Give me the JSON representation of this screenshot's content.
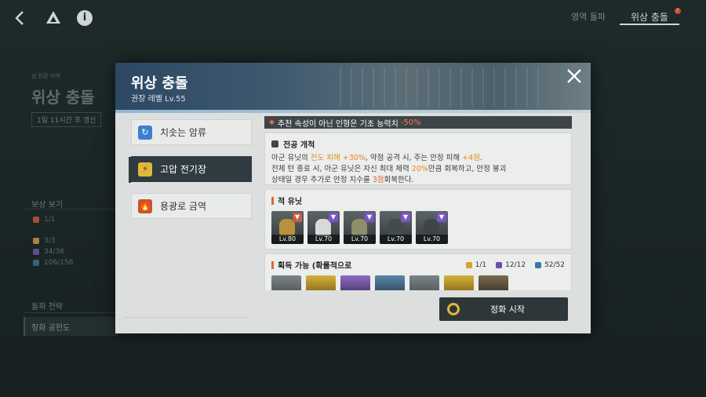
{
  "topbar": {
    "back_icon": "back-arrow-icon",
    "logo_icon": "triangle-logo-icon",
    "info_icon": "info-icon",
    "info_glyph": "i",
    "tab_breakthrough": "영역 돌파",
    "tab_phase_clash": "위상 충돌",
    "badge": "!"
  },
  "background": {
    "small_label": "선 전환 지역",
    "title": "위상 충돌",
    "refresh": "1일 11시간 후 갱신",
    "reward_section": "보상 보기",
    "rows": [
      {
        "value": "1/1",
        "color": "#a84d3b"
      },
      {
        "value": "3/3",
        "color": "#a8843b"
      },
      {
        "value": "34/36",
        "color": "#5b4e8f"
      },
      {
        "value": "106/156",
        "color": "#3b5f7f"
      }
    ],
    "strategy_section": "돌파 전략",
    "strategy_item": "정화 공헌도"
  },
  "modal": {
    "title": "위상 충돌",
    "subtitle": "권장 레벨 Lv.55",
    "close_icon": "close-icon",
    "tabs": [
      {
        "label": "치솟는 암류",
        "icon": "swirl-icon",
        "icon_glyph": "↻",
        "icon_bg": "#3a7fd0",
        "active": false
      },
      {
        "label": "고압 전기장",
        "icon": "lightning-icon",
        "icon_glyph": "⚡",
        "icon_bg": "#e2b739",
        "active": true
      },
      {
        "label": "용광로 금역",
        "icon": "fire-icon",
        "icon_glyph": "🔥",
        "icon_bg": "#d2512a",
        "active": false
      }
    ],
    "warning": {
      "text": "추천 속성이 아닌 인형은 기초 능력치",
      "penalty": "-50%"
    },
    "skill": {
      "title": "전공 개척",
      "line1_a": "아군 유닛의 ",
      "line1_hl1": "전도 피해",
      "line1_b": " ",
      "line1_hl2": "+30%",
      "line1_c": ", 약점 공격 시, 주는 안정 피해 ",
      "line1_hl3": "+4점",
      "line1_d": ".",
      "line2_a": "전체 턴 종료 시, 아군 유닛은 자신 최대 체력 ",
      "line2_hl": "20%",
      "line2_b": "만큼 회복하고, 안정 붕괴",
      "line3_a": "상태일 경우 추가로 안정 지수를 ",
      "line3_hl": "3점",
      "line3_b": "회복한다."
    },
    "enemy": {
      "title": "적 유닛",
      "units": [
        {
          "level": "Lv.80",
          "mark_color": "#c65b4c",
          "fig_color": "#b8923a"
        },
        {
          "level": "Lv.70",
          "mark_color": "#7b55c9",
          "fig_color": "#d9d9d9"
        },
        {
          "level": "Lv.70",
          "mark_color": "#7b55c9",
          "fig_color": "#8c8f6a"
        },
        {
          "level": "Lv.70",
          "mark_color": "#7b55c9",
          "fig_color": "#444b50"
        },
        {
          "level": "Lv.70",
          "mark_color": "#7b55c9",
          "fig_color": "#3e4448"
        }
      ]
    },
    "rewards": {
      "title": "획득 가능 (확률적으로",
      "counts": [
        {
          "value": "1/1",
          "color": "#d9a12a"
        },
        {
          "value": "12/12",
          "color": "#6a4ea8"
        },
        {
          "value": "52/52",
          "color": "#3a77a8"
        }
      ],
      "drops": 7
    },
    "start_button": "정화 시작"
  }
}
